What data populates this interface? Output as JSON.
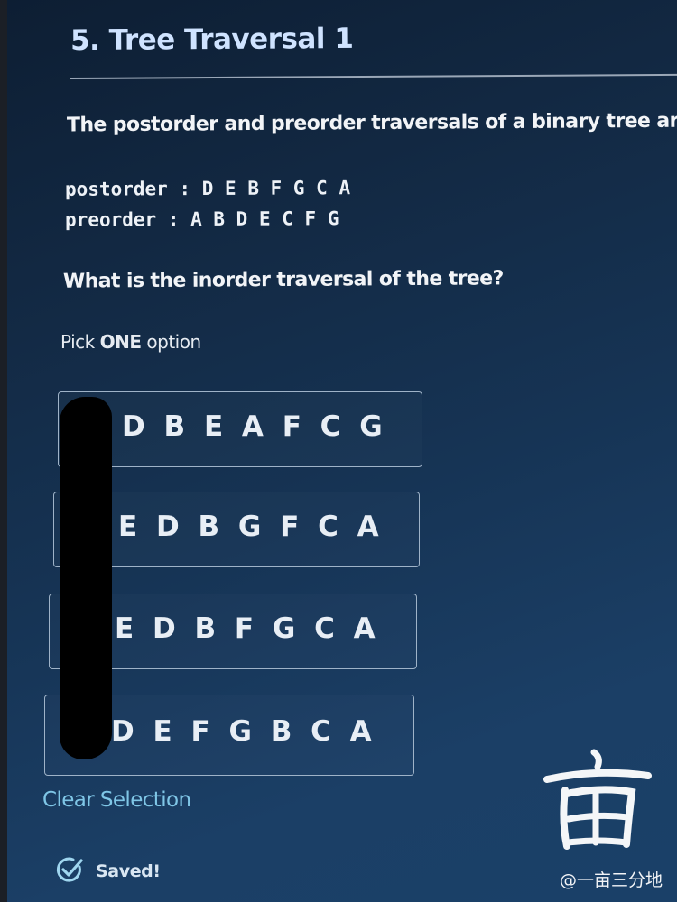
{
  "question": {
    "title": "5. Tree Traversal 1",
    "prompt": "The postorder and preorder traversals of a binary tree are:",
    "postorder": "postorder : D E B F G C A",
    "preorder": "preorder : A B D E C F G",
    "ask": "What is the inorder traversal of the tree?",
    "pick_prefix": "Pick ",
    "pick_bold": "ONE",
    "pick_suffix": " option"
  },
  "options": [
    {
      "label": "D B E A F C G"
    },
    {
      "label": "E D B G F C A"
    },
    {
      "label": "E D B F G C A"
    },
    {
      "label": "D E F G B C A"
    }
  ],
  "clear_selection": "Clear Selection",
  "status": {
    "saved": "Saved!",
    "icon": "check-circle-icon"
  },
  "watermark": {
    "handle": "@一亩三分地",
    "logo": "亩"
  },
  "colors": {
    "title": "#cfe3ff",
    "link": "#7fc6e6",
    "option_border": "#9fb3c8"
  }
}
